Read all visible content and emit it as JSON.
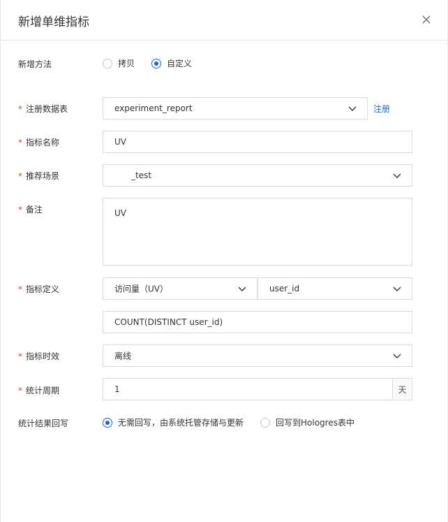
{
  "dialog": {
    "title": "新增单维指标"
  },
  "form": {
    "method": {
      "label": "新增方法",
      "options": [
        "拷贝",
        "自定义"
      ],
      "selected": "自定义"
    },
    "table": {
      "label": "注册数据表",
      "value": "experiment_report",
      "link": "注册"
    },
    "name": {
      "label": "指标名称",
      "value": "UV"
    },
    "scene": {
      "label": "推荐场景",
      "value": "_test"
    },
    "remark": {
      "label": "备注",
      "value": "UV"
    },
    "definition": {
      "label": "指标定义",
      "metric": "访问量（UV）",
      "field": "user_id",
      "expression": "COUNT(DISTINCT user_id)"
    },
    "timeliness": {
      "label": "指标时效",
      "value": "离线"
    },
    "period": {
      "label": "统计周期",
      "value": "1",
      "unit": "天"
    },
    "writeback": {
      "label": "统计结果回写",
      "options": [
        "无需回写，由系统托管存储与更新",
        "回写到Hologres表中"
      ],
      "selected": "无需回写，由系统托管存储与更新"
    }
  },
  "icons": {
    "close": "close-icon",
    "dropdown": "chevron-down-icon"
  },
  "colors": {
    "accent": "#1565d8",
    "required": "#e23c39",
    "border": "#dcdcdc"
  }
}
